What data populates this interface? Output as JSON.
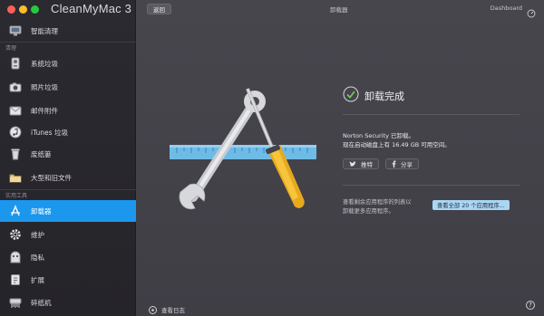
{
  "app": {
    "title": "CleanMyMac 3"
  },
  "sidebar": {
    "sections": {
      "clean": "清理",
      "utilities": "实用工具"
    },
    "items": [
      {
        "label": "智能清理",
        "icon": "monitor-icon"
      },
      {
        "label": "系统垃圾",
        "icon": "system-junk-icon"
      },
      {
        "label": "照片垃圾",
        "icon": "camera-icon"
      },
      {
        "label": "邮件附件",
        "icon": "mail-icon"
      },
      {
        "label": "iTunes 垃圾",
        "icon": "music-note-icon"
      },
      {
        "label": "废纸篓",
        "icon": "trash-icon"
      },
      {
        "label": "大型和旧文件",
        "icon": "folder-icon"
      },
      {
        "label": "卸载器",
        "icon": "app-store-icon"
      },
      {
        "label": "维护",
        "icon": "gear-icon"
      },
      {
        "label": "隐私",
        "icon": "privacy-icon"
      },
      {
        "label": "扩展",
        "icon": "puzzle-icon"
      },
      {
        "label": "碎纸机",
        "icon": "shredder-icon"
      }
    ],
    "active_index": 7,
    "active_color": "#1b97ee"
  },
  "topbar": {
    "back_label": "返回",
    "title": "卸载器",
    "dashboard_label": "Dashboard"
  },
  "result": {
    "status": "卸载完成",
    "line1": "Norton Security 已卸载。",
    "line2": "现在启动磁盘上有 16.49 GB 可用空间。",
    "tweet_label": "推特",
    "share_label": "分享"
  },
  "hint": {
    "line1": "查看剩余应用程序的列表以",
    "line2": "卸载更多应用程序。",
    "button_label": "查看全部 20 个应用程序..."
  },
  "footer": {
    "log_label": "查看日志",
    "help_label": "?"
  }
}
